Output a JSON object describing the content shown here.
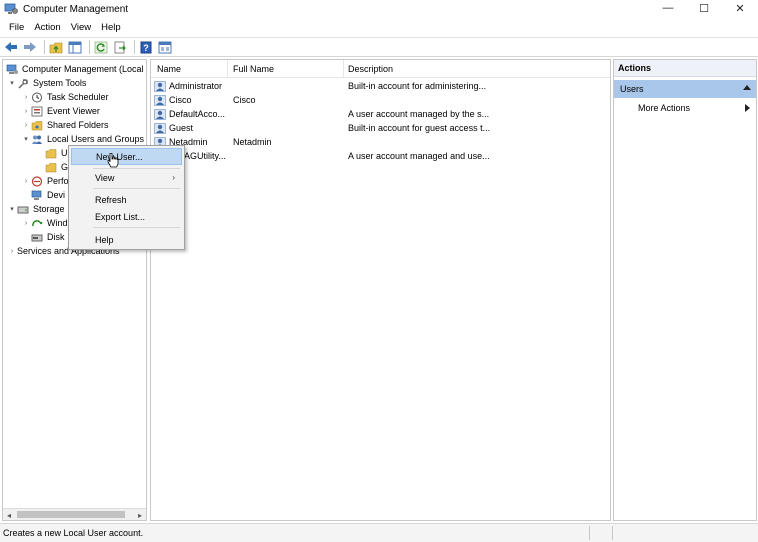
{
  "window": {
    "title": "Computer Management",
    "controls": {
      "minimize": "—",
      "maximize": "☐",
      "close": "✕"
    }
  },
  "menubar": [
    "File",
    "Action",
    "View",
    "Help"
  ],
  "toolbar": [
    "back-icon",
    "forward-icon",
    "up-folder-icon",
    "show-hide-tree-icon",
    "refresh-icon",
    "export-icon",
    "help-icon",
    "properties-icon"
  ],
  "tree": {
    "items": [
      {
        "label": "Computer Management (Local",
        "expander": "",
        "icon": "computer-icon"
      },
      {
        "label": "System Tools",
        "expander": "▾",
        "icon": "tools-icon"
      },
      {
        "label": "Task Scheduler",
        "expander": "›",
        "icon": "clock-icon"
      },
      {
        "label": "Event Viewer",
        "expander": "›",
        "icon": "event-viewer-icon"
      },
      {
        "label": "Shared Folders",
        "expander": "›",
        "icon": "shared-folder-icon"
      },
      {
        "label": "Local Users and Groups",
        "expander": "▾",
        "icon": "users-group-icon"
      },
      {
        "label": "U",
        "expander": "",
        "icon": "folder-icon"
      },
      {
        "label": "G",
        "expander": "",
        "icon": "folder-icon"
      },
      {
        "label": "Perfo",
        "expander": "›",
        "icon": "performance-icon"
      },
      {
        "label": "Devi",
        "expander": "",
        "icon": "device-manager-icon"
      },
      {
        "label": "Storage",
        "expander": "▾",
        "icon": "storage-icon"
      },
      {
        "label": "Wind",
        "expander": "›",
        "icon": "backup-icon"
      },
      {
        "label": "Disk",
        "expander": "",
        "icon": "disk-icon"
      },
      {
        "label": "Services and Applications",
        "expander": "›",
        "icon": "services-icon"
      }
    ]
  },
  "list": {
    "columns": [
      "Name",
      "Full Name",
      "Description"
    ],
    "rows": [
      {
        "name": "Administrator",
        "full_name": "",
        "description": "Built-in account for administering..."
      },
      {
        "name": "Cisco",
        "full_name": "Cisco",
        "description": ""
      },
      {
        "name": "DefaultAcco...",
        "full_name": "",
        "description": "A user account managed by the s..."
      },
      {
        "name": "Guest",
        "full_name": "",
        "description": "Built-in account for guest access t..."
      },
      {
        "name": "Netadmin",
        "full_name": "Netadmin",
        "description": ""
      },
      {
        "name": "WDAGUtility...",
        "full_name": "",
        "description": "A user account managed and use..."
      }
    ]
  },
  "actions": {
    "header": "Actions",
    "group": "Users",
    "more_actions": "More Actions"
  },
  "context_menu": {
    "items": [
      "New User...",
      "View",
      "Refresh",
      "Export List...",
      "Help"
    ],
    "submenu_glyph": "›"
  },
  "statusbar": {
    "text": "Creates a new Local User account."
  },
  "colors": {
    "selection": "#bfd9f3",
    "actions_group": "#a9c6eb",
    "icon_blue": "#2d6fb8",
    "folder_yellow": "#e8c04a"
  }
}
